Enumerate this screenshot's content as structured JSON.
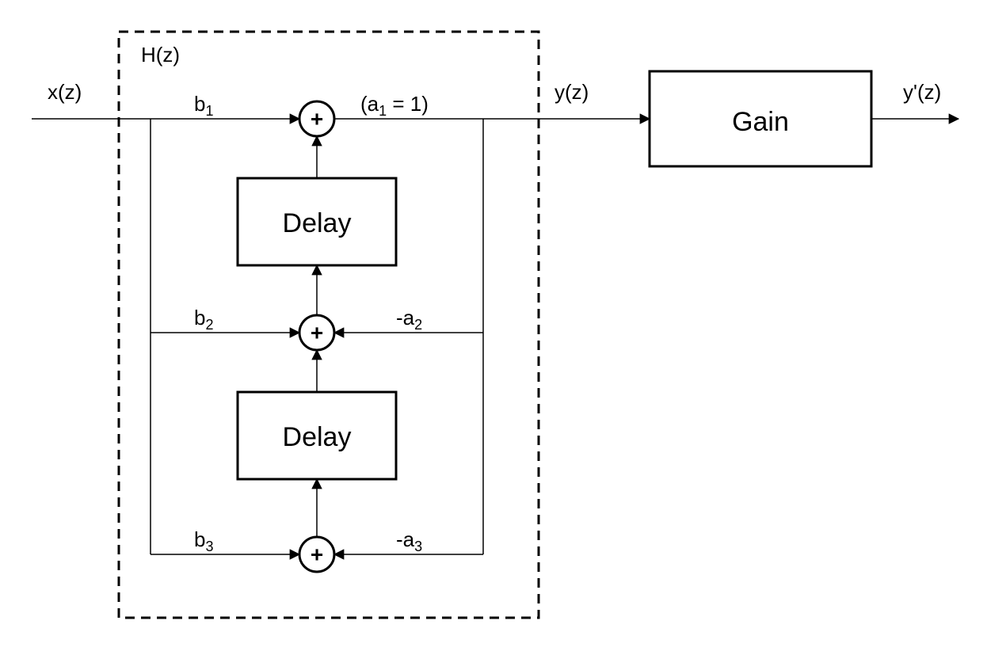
{
  "diagram": {
    "input_label": "x(z)",
    "hz_label": "H(z)",
    "b1_label_base": "b",
    "b1_label_sub": "1",
    "a1_label": "(a",
    "a1_label_sub": "1",
    "a1_label_tail": " = 1)",
    "y_label": "y(z)",
    "gain_label": "Gain",
    "yprime_label": "y'(z)",
    "delay1_label": "Delay",
    "b2_label_base": "b",
    "b2_label_sub": "2",
    "neg_a2_label_base": "-a",
    "neg_a2_label_sub": "2",
    "delay2_label": "Delay",
    "b3_label_base": "b",
    "b3_label_sub": "3",
    "neg_a3_label_base": "-a",
    "neg_a3_label_sub": "3",
    "plus": "+"
  }
}
